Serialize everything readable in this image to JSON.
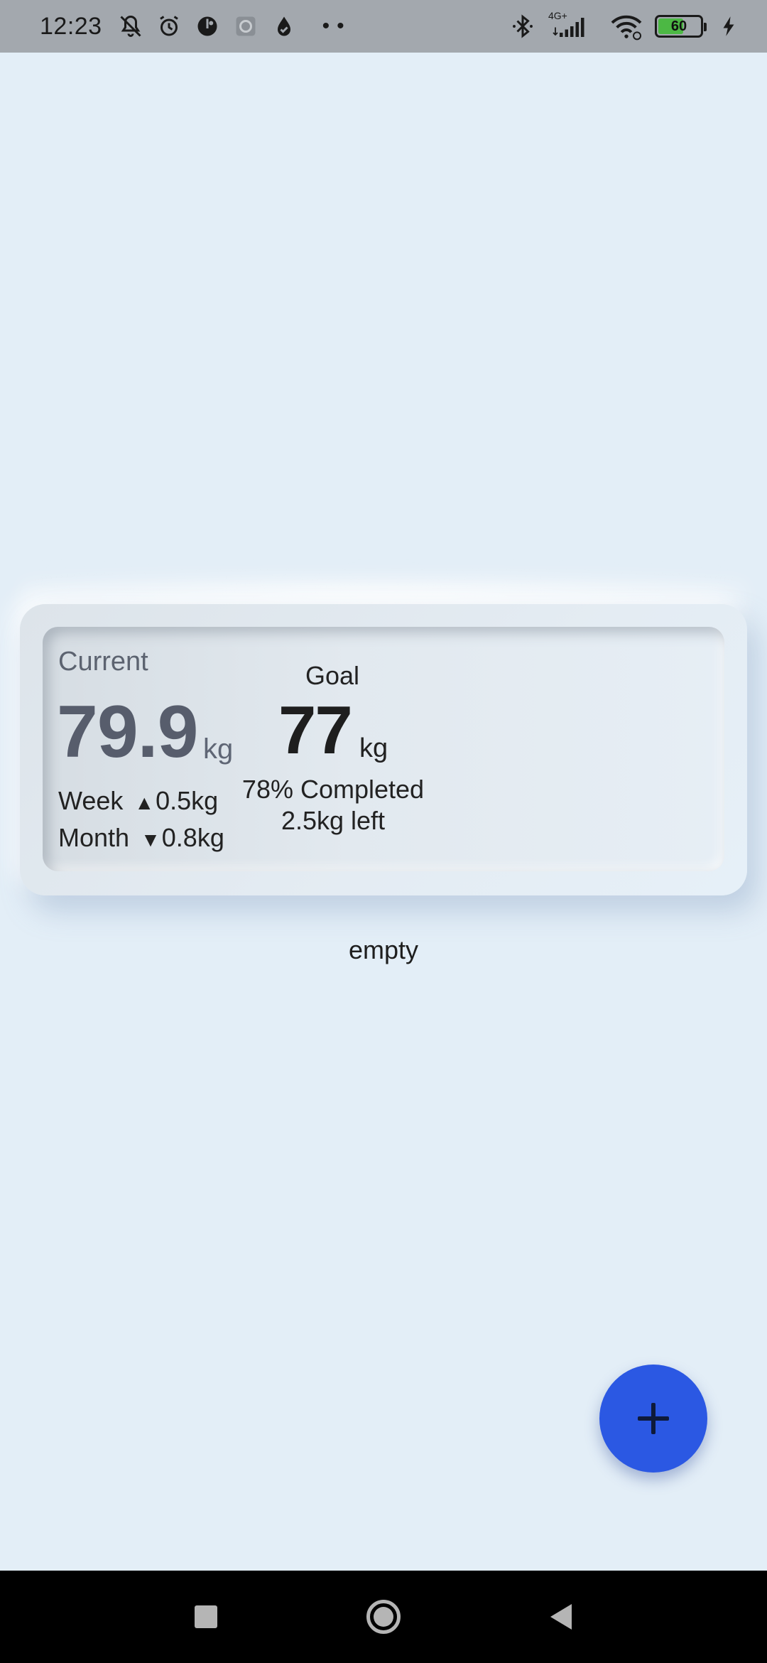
{
  "status_bar": {
    "time": "12:23",
    "network_label": "4G+",
    "battery_level": "60",
    "battery_fraction": 0.6,
    "icons": [
      "mute-icon",
      "alarm-icon",
      "app-icon",
      "screen-record-icon",
      "drop-icon",
      "more-dots",
      "bluetooth-icon",
      "signal-icon",
      "wifi-icon",
      "battery-icon",
      "charging-icon"
    ]
  },
  "weight_card": {
    "current": {
      "label": "Current",
      "value": "79.9",
      "unit": "kg",
      "week_label": "Week",
      "week_arrow": "▲",
      "week_change": "0.5kg",
      "month_label": "Month",
      "month_arrow": "▼",
      "month_change": "0.8kg"
    },
    "goal": {
      "label": "Goal",
      "value": "77",
      "unit": "kg",
      "completed": "78% Completed",
      "left": "2.5kg left"
    }
  },
  "list": {
    "empty_text": "empty"
  },
  "fab": {
    "icon": "plus-icon"
  },
  "colors": {
    "background": "#e3eef7",
    "fab": "#2b58e3",
    "current_value": "#575d6c"
  }
}
